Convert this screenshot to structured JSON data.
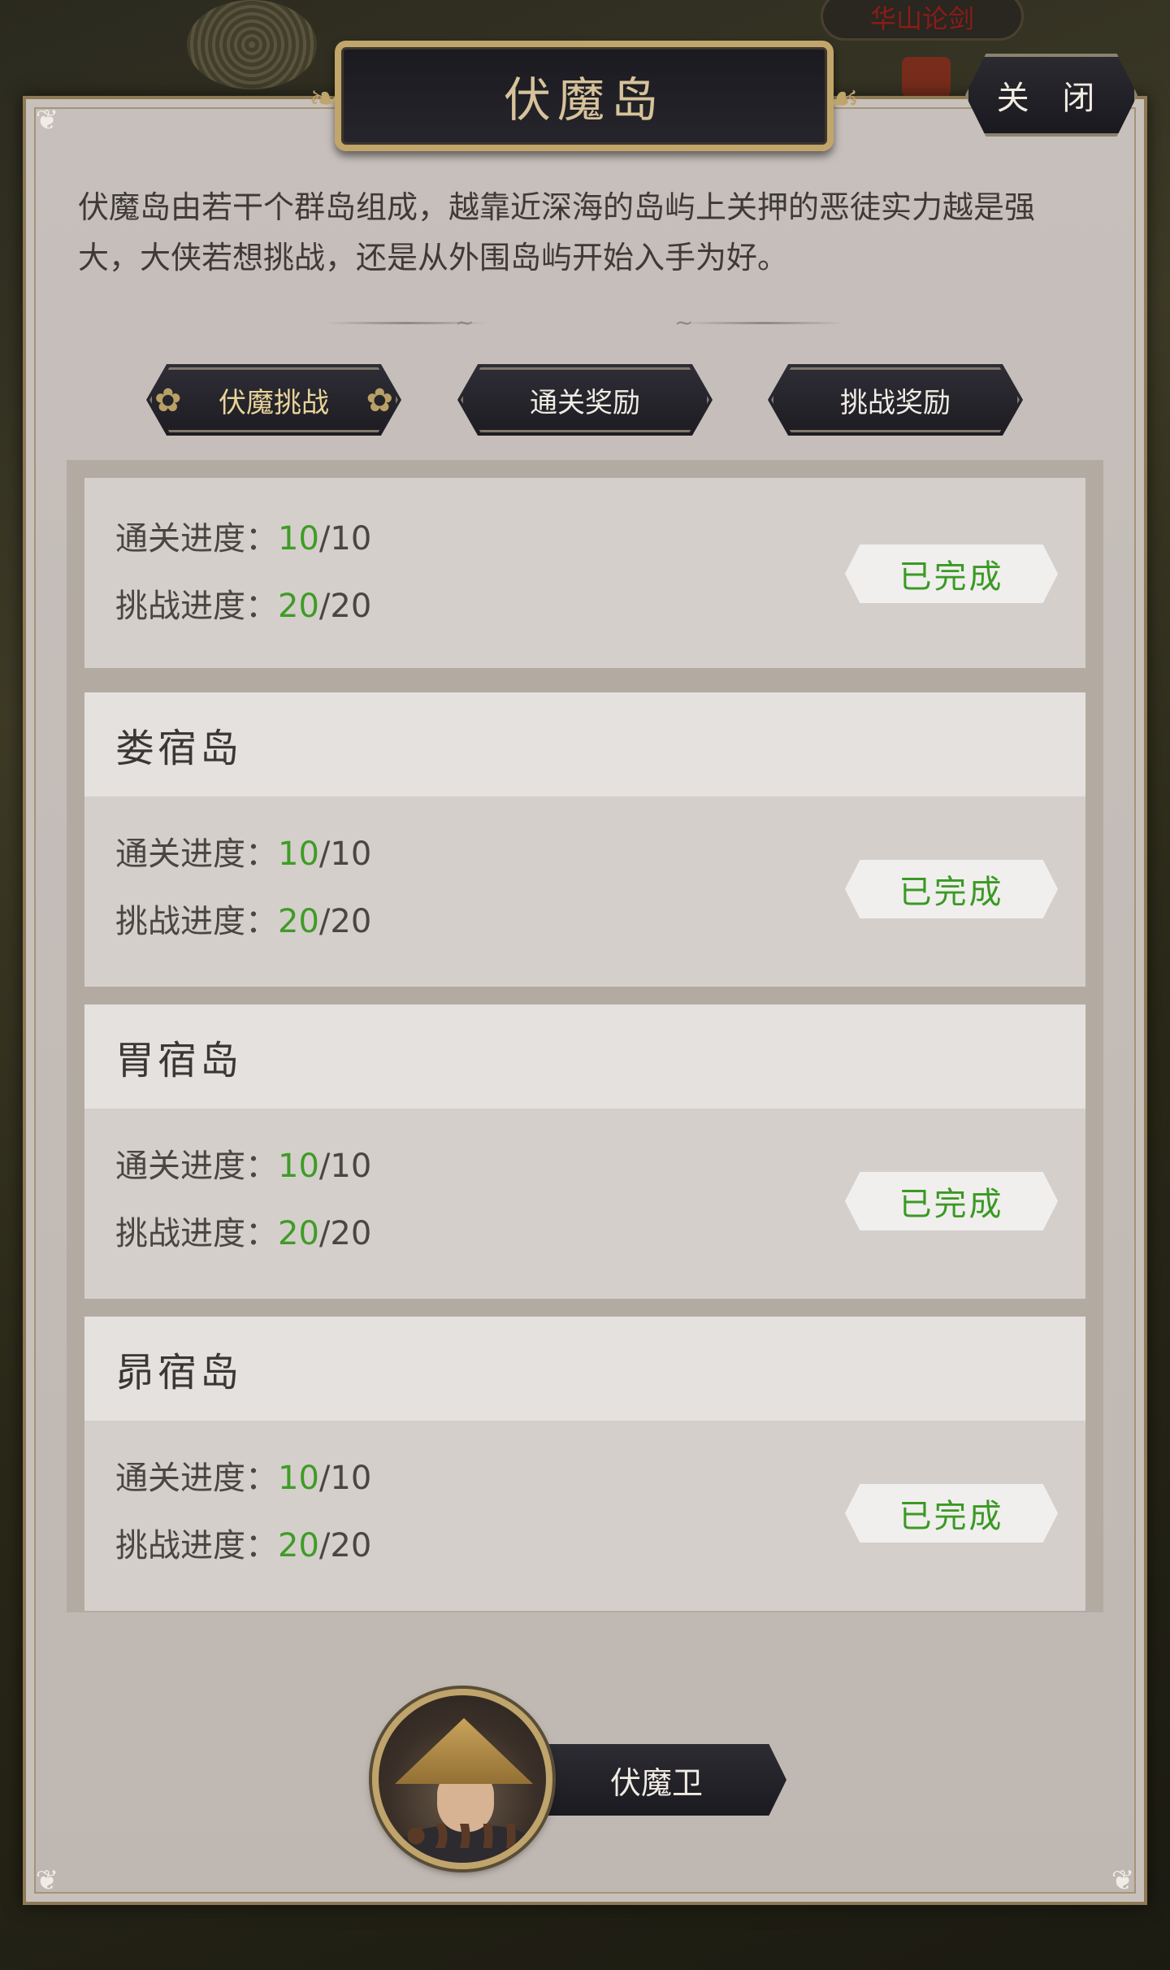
{
  "background": {
    "map_tag": "华山论剑"
  },
  "dialog": {
    "title": "伏魔岛",
    "close_label": "关 闭",
    "description": "伏魔岛由若干个群岛组成，越靠近深海的岛屿上关押的恶徒实力越是强大，大侠若想挑战，还是从外围岛屿开始入手为好。"
  },
  "tabs": [
    {
      "label": "伏魔挑战",
      "active": true
    },
    {
      "label": "通关奖励",
      "active": false
    },
    {
      "label": "挑战奖励",
      "active": false
    }
  ],
  "progress_labels": {
    "clear": "通关进度：",
    "challenge": "挑战进度："
  },
  "islands": [
    {
      "name": "",
      "clear_current": "10",
      "clear_total": "/10",
      "challenge_current": "20",
      "challenge_total": "/20",
      "status": "已完成"
    },
    {
      "name": "娄宿岛",
      "clear_current": "10",
      "clear_total": "/10",
      "challenge_current": "20",
      "challenge_total": "/20",
      "status": "已完成"
    },
    {
      "name": "胃宿岛",
      "clear_current": "10",
      "clear_total": "/10",
      "challenge_current": "20",
      "challenge_total": "/20",
      "status": "已完成"
    },
    {
      "name": "昴宿岛",
      "clear_current": "10",
      "clear_total": "/10",
      "challenge_current": "20",
      "challenge_total": "/20",
      "status": "已完成"
    }
  ],
  "guard": {
    "label": "伏魔卫"
  },
  "colors": {
    "progress_current": "#3f9c26",
    "status_text": "#3a9a24",
    "title_gold": "#d7c39a",
    "frame_gold": "#c2a56a"
  }
}
